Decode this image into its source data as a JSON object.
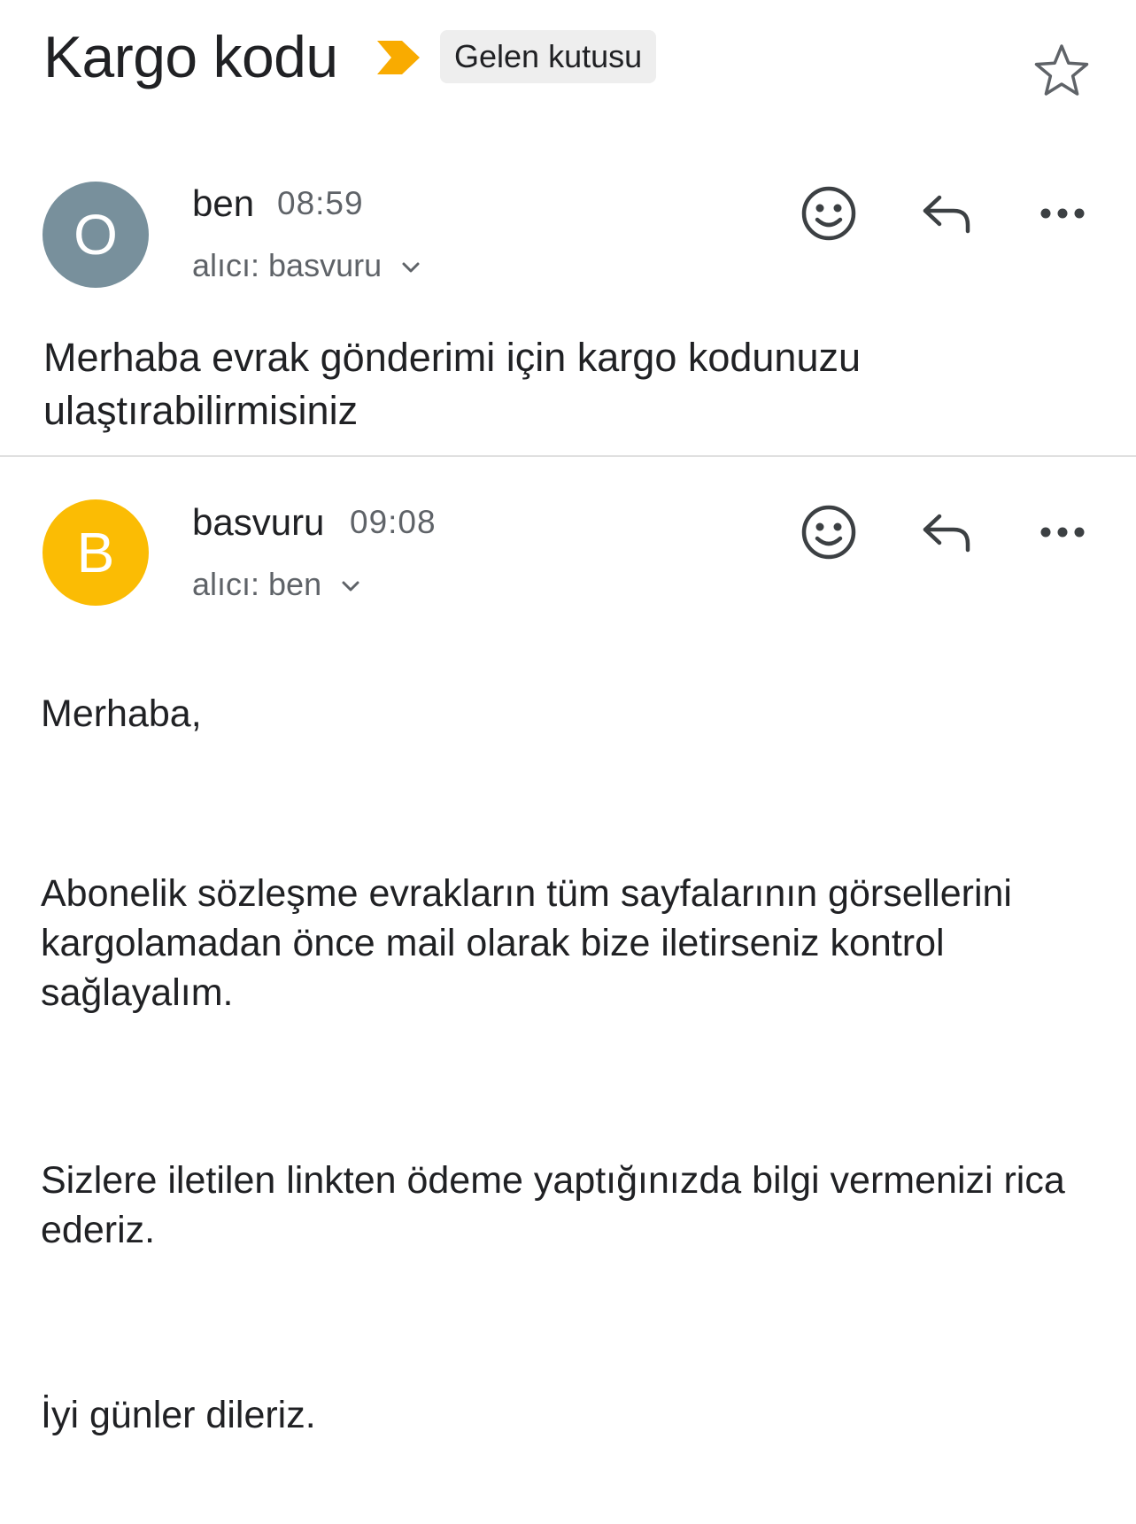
{
  "header": {
    "subject": "Kargo kodu",
    "label": "Gelen kutusu",
    "importance_color": "#f9ab00",
    "importance_icon": "importance-marker-icon",
    "star_icon": "star-outline-icon"
  },
  "messages": [
    {
      "avatar_letter": "O",
      "avatar_color": "#78909c",
      "sender": "ben",
      "time": "08:59",
      "recipient": "alıcı: basvuru",
      "snippet": "Merhaba evrak gönderimi için kargo kodunuzu ulaştırabilirmisiniz",
      "actions": [
        "emoji-reaction-icon",
        "reply-icon",
        "more-options-icon"
      ]
    },
    {
      "avatar_letter": "B",
      "avatar_color": "#fbbc04",
      "sender": "basvuru",
      "time": "09:08",
      "recipient": "alıcı: ben",
      "body": [
        "Merhaba,",
        "Abonelik sözleşme evrakların tüm sayfalarının görsellerini kargolamadan önce mail olarak bize iletirseniz kontrol sağlayalım.",
        "Sizlere iletilen linkten ödeme yaptığınızda bilgi vermenizi rica ederiz.",
        "İyi günler dileriz."
      ],
      "actions": [
        "emoji-reaction-icon",
        "reply-icon",
        "more-options-icon"
      ]
    }
  ]
}
